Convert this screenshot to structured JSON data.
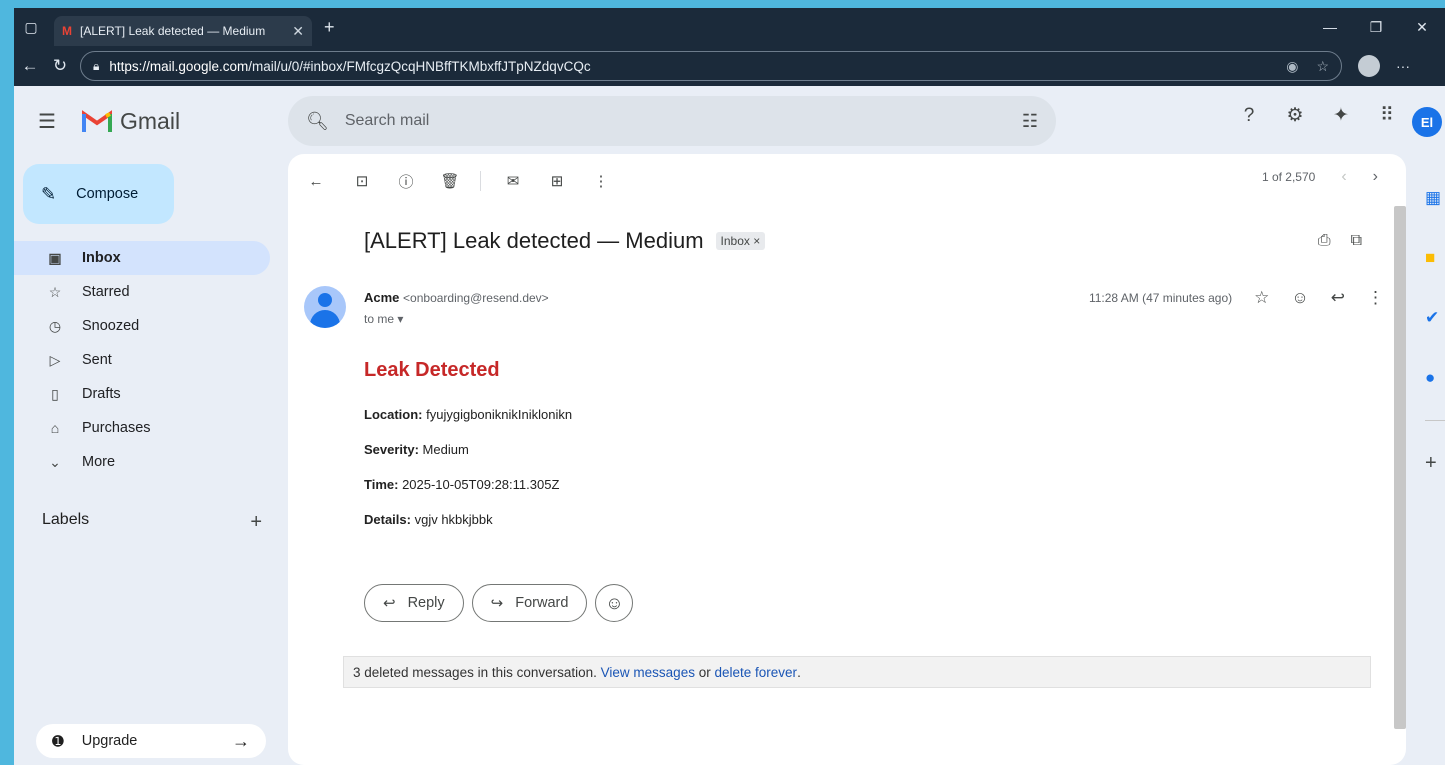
{
  "browser": {
    "tab_title": "[ALERT] Leak detected — Medium",
    "url_host": "https://mail.google.com",
    "url_path": "/mail/u/0/#inbox/FMfcgzQcqHNBffTKMbxffJTpNZdqvCQc"
  },
  "app": {
    "name": "Gmail",
    "avatar_initials": "El"
  },
  "search": {
    "placeholder": "Search mail"
  },
  "compose": {
    "label": "Compose"
  },
  "sidebar": {
    "items": [
      {
        "label": "Inbox",
        "icon": "inbox-icon",
        "active": true
      },
      {
        "label": "Starred",
        "icon": "star-icon"
      },
      {
        "label": "Snoozed",
        "icon": "clock-icon"
      },
      {
        "label": "Sent",
        "icon": "send-icon"
      },
      {
        "label": "Drafts",
        "icon": "draft-icon"
      },
      {
        "label": "Purchases",
        "icon": "bag-icon"
      },
      {
        "label": "More",
        "icon": "chevron-down-icon"
      }
    ],
    "labels_heading": "Labels",
    "upgrade_label": "Upgrade"
  },
  "toolbar": {
    "pager": "1 of 2,570"
  },
  "email": {
    "subject": "[ALERT] Leak detected — Medium",
    "chip": "Inbox",
    "sender_name": "Acme",
    "sender_email": "<onboarding@resend.dev>",
    "to": "to me",
    "time": "11:28 AM (47 minutes ago)",
    "heading": "Leak Detected",
    "fields": [
      {
        "label": "Location:",
        "value": "fyujygigboniknikIniklonikn"
      },
      {
        "label": "Severity:",
        "value": "Medium"
      },
      {
        "label": "Time:",
        "value": "2025-10-05T09:28:11.305Z"
      },
      {
        "label": "Details:",
        "value": "vgjv hkbkjbbk"
      }
    ],
    "reply_label": "Reply",
    "forward_label": "Forward"
  },
  "deleted_notice": {
    "text": "3 deleted messages in this conversation.",
    "view_link": "View messages",
    "or": "or",
    "delete_link": "delete forever",
    "period": "."
  },
  "colors": {
    "alert_red": "#c62828",
    "compose_bg": "#c2e7ff",
    "active_nav": "#d3e3fd",
    "link": "#1a55b5"
  }
}
